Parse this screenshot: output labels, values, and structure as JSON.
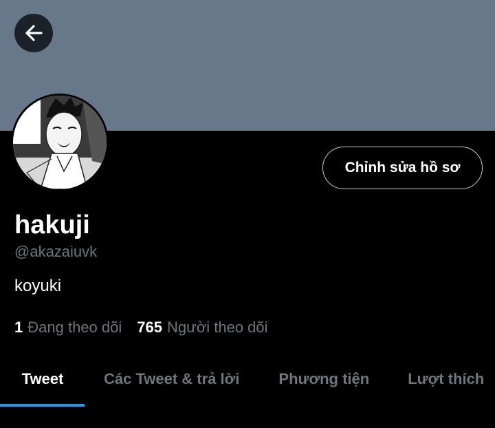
{
  "header": {
    "back_icon": "arrow-left-icon",
    "banner_color": "#66788a"
  },
  "profile": {
    "avatar": "manga-character-avatar",
    "edit_label": "Chỉnh sửa hồ sơ",
    "display_name": "hakuji",
    "handle": "@akazaiuvk",
    "bio": "koyuki",
    "following_count": "1",
    "following_label": "Đang theo dõi",
    "followers_count": "765",
    "followers_label": "Người theo dõi"
  },
  "tabs": [
    {
      "label": "Tweet",
      "active": true
    },
    {
      "label": "Các Tweet & trả lời",
      "active": false
    },
    {
      "label": "Phương tiện",
      "active": false
    },
    {
      "label": "Lượt thích",
      "active": false
    }
  ],
  "colors": {
    "background": "#000000",
    "secondary_text": "#6e767d",
    "accent": "#1d9bf0"
  }
}
